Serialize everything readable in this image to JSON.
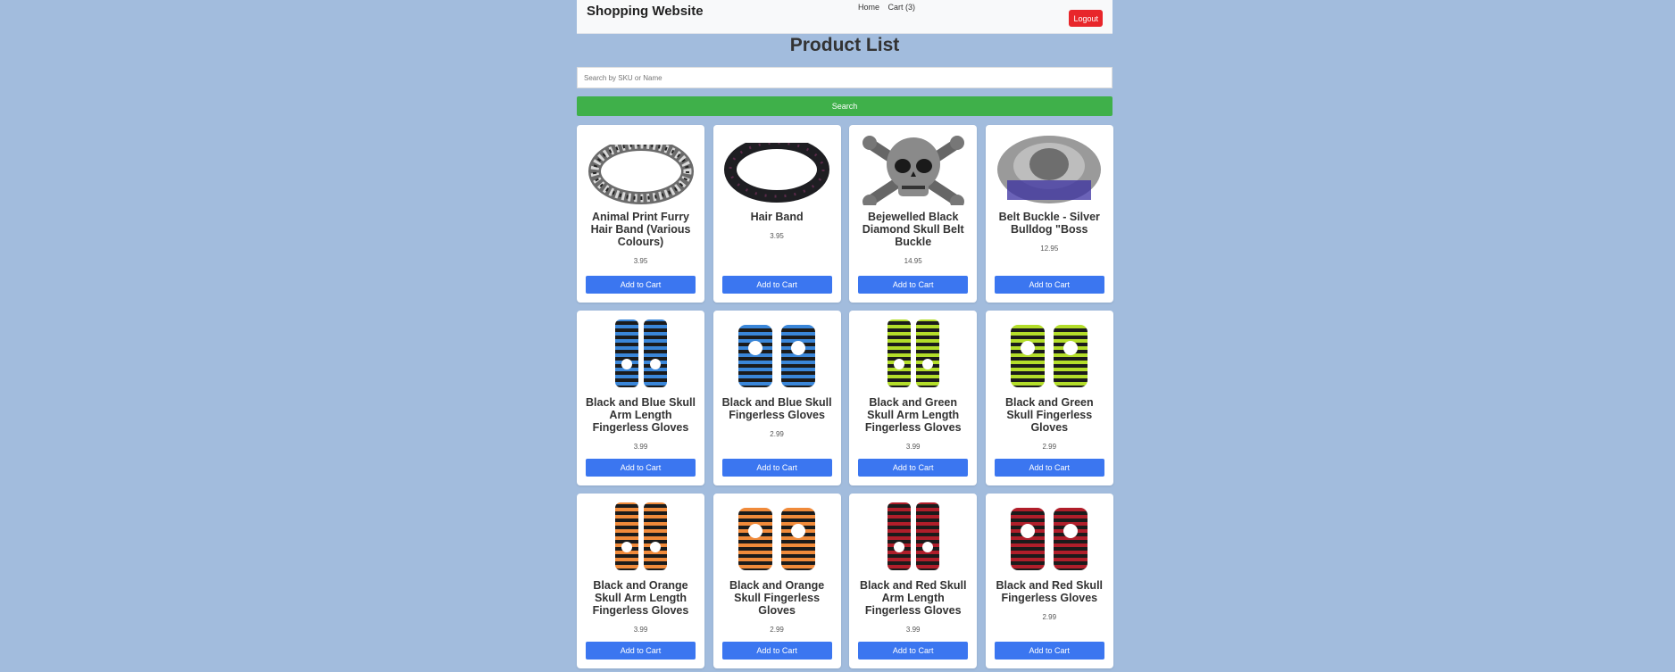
{
  "navbar": {
    "brand": "Shopping Website",
    "home_label": "Home",
    "cart_label": "Cart (3)",
    "logout_label": "Logout"
  },
  "page": {
    "title": "Product List",
    "search_placeholder": "Search by SKU or Name",
    "search_button": "Search"
  },
  "products": [
    {
      "name": "Animal Print Furry Hair Band (Various Colours)",
      "price": "3.95",
      "button": "Add to Cart",
      "image_icon": "leopard-headband"
    },
    {
      "name": "Hair Band",
      "price": "3.95",
      "button": "Add to Cart",
      "image_icon": "black-headband"
    },
    {
      "name": "Bejewelled Black Diamond Skull Belt Buckle",
      "price": "14.95",
      "button": "Add to Cart",
      "image_icon": "skull-buckle"
    },
    {
      "name": "Belt Buckle - Silver Bulldog \"Boss",
      "price": "12.95",
      "button": "Add to Cart",
      "image_icon": "bulldog-buckle"
    },
    {
      "name": "Black and Blue Skull Arm Length Fingerless Gloves",
      "price": "3.99",
      "button": "Add to Cart",
      "image_icon": "blue-arm-gloves"
    },
    {
      "name": "Black and Blue Skull Fingerless Gloves",
      "price": "2.99",
      "button": "Add to Cart",
      "image_icon": "blue-short-gloves"
    },
    {
      "name": "Black and Green Skull Arm Length Fingerless Gloves",
      "price": "3.99",
      "button": "Add to Cart",
      "image_icon": "green-arm-gloves"
    },
    {
      "name": "Black and Green Skull Fingerless Gloves",
      "price": "2.99",
      "button": "Add to Cart",
      "image_icon": "green-short-gloves"
    },
    {
      "name": "Black and Orange Skull Arm Length Fingerless Gloves",
      "price": "3.99",
      "button": "Add to Cart",
      "image_icon": "orange-arm-gloves"
    },
    {
      "name": "Black and Orange Skull Fingerless Gloves",
      "price": "2.99",
      "button": "Add to Cart",
      "image_icon": "orange-short-gloves"
    },
    {
      "name": "Black and Red Skull Arm Length Fingerless Gloves",
      "price": "3.99",
      "button": "Add to Cart",
      "image_icon": "red-arm-gloves"
    },
    {
      "name": "Black and Red Skull Fingerless Gloves",
      "price": "2.99",
      "button": "Add to Cart",
      "image_icon": "red-short-gloves"
    }
  ],
  "colors": {
    "background": "#a2bcdd",
    "search_button": "#3fb04a",
    "add_button": "#3b76f0",
    "logout_button": "#e8262b",
    "glove_blue": "#3a86d8",
    "glove_green": "#b3dd2a",
    "glove_orange": "#f08a3a",
    "glove_red": "#b01e2a"
  }
}
